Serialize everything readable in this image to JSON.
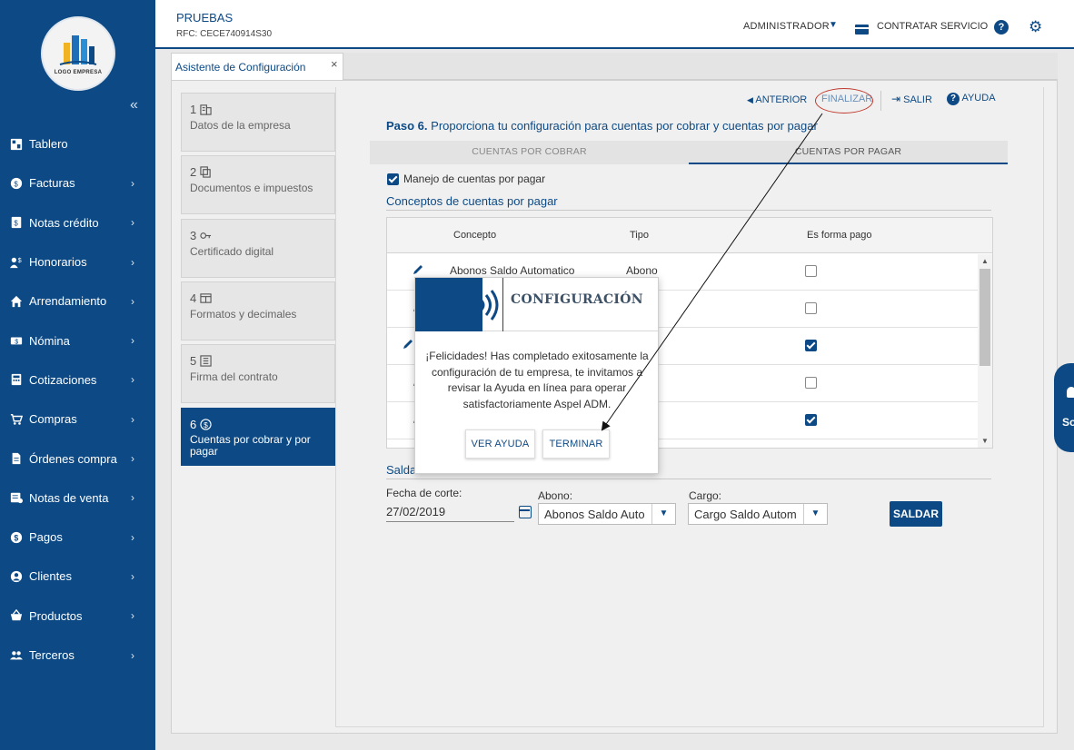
{
  "sidebar": {
    "logo_text": "LOGO EMPRESA",
    "collapse": "«",
    "items": [
      {
        "label": "Tablero",
        "icon": "dashboard-icon",
        "chevron": ""
      },
      {
        "label": "Facturas",
        "icon": "invoice-icon",
        "chevron": "›"
      },
      {
        "label": "Notas crédito",
        "icon": "credit-note-icon",
        "chevron": "›"
      },
      {
        "label": "Honorarios",
        "icon": "fees-icon",
        "chevron": "›"
      },
      {
        "label": "Arrendamiento",
        "icon": "home-icon",
        "chevron": "›"
      },
      {
        "label": "Nómina",
        "icon": "payroll-icon",
        "chevron": "›"
      },
      {
        "label": "Cotizaciones",
        "icon": "calculator-icon",
        "chevron": "›"
      },
      {
        "label": "Compras",
        "icon": "cart-icon",
        "chevron": "›"
      },
      {
        "label": "Órdenes compra",
        "icon": "document-icon",
        "chevron": "›"
      },
      {
        "label": "Notas de venta",
        "icon": "sales-note-icon",
        "chevron": "›"
      },
      {
        "label": "Pagos",
        "icon": "dollar-icon",
        "chevron": "›"
      },
      {
        "label": "Clientes",
        "icon": "user-icon",
        "chevron": "›"
      },
      {
        "label": "Productos",
        "icon": "basket-icon",
        "chevron": "›"
      },
      {
        "label": "Terceros",
        "icon": "people-icon",
        "chevron": "›"
      }
    ]
  },
  "header": {
    "company": "PRUEBAS",
    "rfc": "RFC: CECE740914S30",
    "user": "ADMINISTRADOR",
    "contract": "CONTRATAR SERVICIO",
    "help": "?"
  },
  "tabbar": {
    "tab_label": "Asistente de Configuración",
    "close": "×"
  },
  "steps": [
    {
      "num": "1",
      "label": "Datos de la empresa",
      "icon": "building-icon"
    },
    {
      "num": "2",
      "label": "Documentos e impuestos",
      "icon": "copy-icon"
    },
    {
      "num": "3",
      "label": "Certificado digital",
      "icon": "key-icon"
    },
    {
      "num": "4",
      "label": "Formatos y decimales",
      "icon": "format-icon"
    },
    {
      "num": "5",
      "label": "Firma del contrato",
      "icon": "list-icon"
    },
    {
      "num": "6",
      "label": "Cuentas por cobrar y por pagar",
      "icon": "dollar-circle-icon"
    }
  ],
  "topnav": {
    "anterior": "ANTERIOR",
    "finalizar": "FINALIZAR",
    "salir": "SALIR",
    "ayuda": "AYUDA"
  },
  "paso": {
    "prefix": "Paso 6.",
    "text": " Proporciona tu configuración para cuentas por cobrar y cuentas por pagar"
  },
  "subtabs": {
    "left": "CUENTAS POR COBRAR",
    "right": "CUENTAS POR PAGAR"
  },
  "manejo_label": "Manejo de cuentas por pagar",
  "conceptos_title": "Conceptos de cuentas por pagar",
  "table": {
    "headers": {
      "concepto": "Concepto",
      "tipo": "Tipo",
      "forma": "Es forma pago"
    },
    "rows": [
      {
        "concepto": "Abonos Saldo Automatico",
        "tipo": "Abono",
        "forma": false
      },
      {
        "concepto": "",
        "tipo": "",
        "forma": false
      },
      {
        "concepto": "",
        "tipo": "",
        "forma": true
      },
      {
        "concepto": "",
        "tipo": "",
        "forma": false
      },
      {
        "concepto": "",
        "tipo": "",
        "forma": true
      }
    ],
    "scroll_up": "▲",
    "scroll_down": "▼"
  },
  "saldar": {
    "title": "Salda",
    "fecha_label": "Fecha de corte:",
    "fecha_value": "27/02/2019",
    "abono_label": "Abono:",
    "abono_value": "Abonos Saldo Auto",
    "cargo_label": "Cargo:",
    "cargo_value": "Cargo Saldo Autom",
    "button": "SALDAR"
  },
  "modal": {
    "title": "CONFIGURACIÓN",
    "message": "¡Felicidades! Has completado exitosamente la configuración de tu empresa, te invitamos a revisar la Ayuda en línea para operar satisfactoriamente Aspel ADM.",
    "btn_help": "VER AYUDA",
    "btn_finish": "TERMINAR"
  },
  "side_tab": {
    "label": "So"
  },
  "colors": {
    "brand": "#0d4a85",
    "annotation": "#c0392b"
  }
}
